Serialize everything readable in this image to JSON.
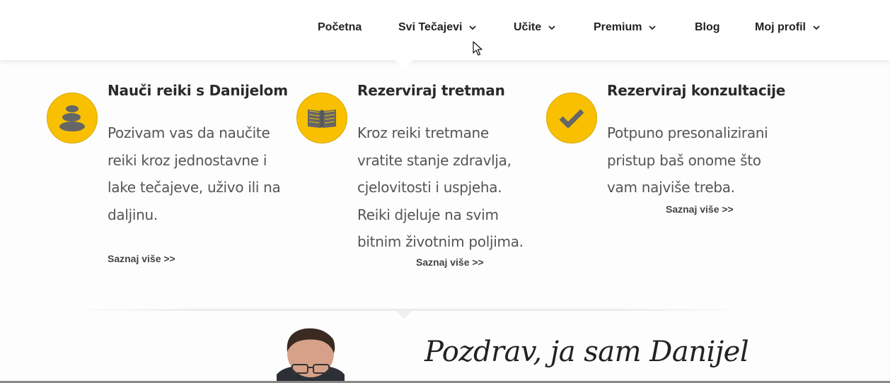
{
  "nav": {
    "items": [
      {
        "label": "Početna",
        "has_dropdown": false
      },
      {
        "label": "Svi Tečajevi",
        "has_dropdown": true
      },
      {
        "label": "Učite",
        "has_dropdown": true
      },
      {
        "label": "Premium",
        "has_dropdown": true
      },
      {
        "label": "Blog",
        "has_dropdown": false
      },
      {
        "label": "Moj profil",
        "has_dropdown": true
      }
    ]
  },
  "features": [
    {
      "icon": "stones-icon",
      "title": "Nauči reiki s Danijelom",
      "lines": [
        "Pozivam vas da naučite",
        "reiki kroz jednostavne i",
        "lake tečajeve, uživo ili na",
        "daljinu."
      ],
      "link": "Saznaj više >>"
    },
    {
      "icon": "book-icon",
      "title": "Rezerviraj tretman",
      "lines": [
        "Kroz reiki tretmane",
        "vratite stanje zdravlja,",
        "cjelovitosti i uspjeha.",
        "Reiki djeluje na svim",
        "bitnim životnim poljima."
      ],
      "link": "Saznaj više >>"
    },
    {
      "icon": "check-icon",
      "title": "Rezerviraj konzultacije",
      "lines": [
        "Potpuno presonalizirani",
        "pristup baš onome što",
        "vam najviše treba."
      ],
      "link": "Saznaj više >>"
    }
  ],
  "intro": {
    "greeting": "Pozdrav, ja sam Danijel"
  },
  "colors": {
    "accent": "#f8c000",
    "icon_glyph": "#666666",
    "heading": "#2a2a2a",
    "body_text": "#555555"
  }
}
